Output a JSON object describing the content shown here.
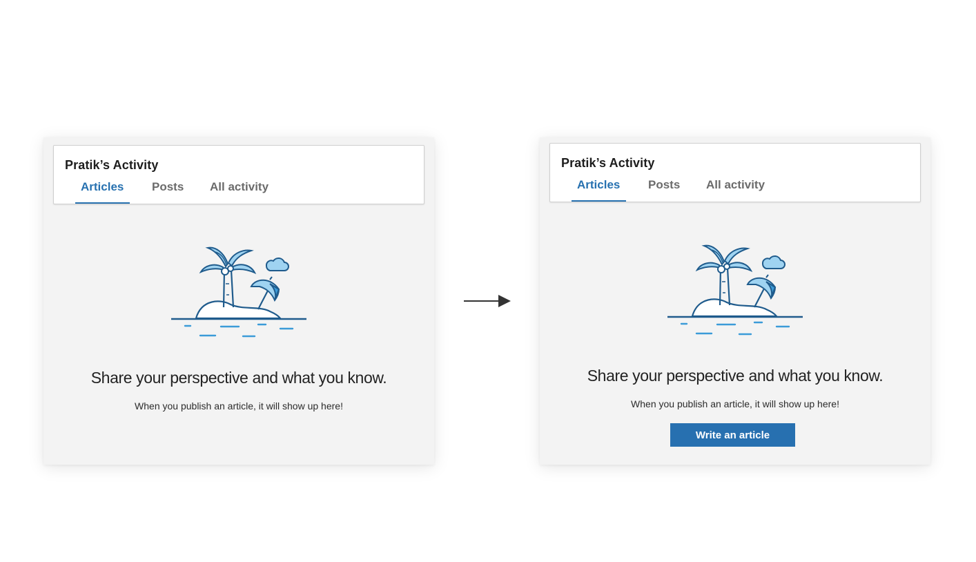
{
  "before": {
    "header": {
      "title": "Pratik’s Activity"
    },
    "tabs": [
      {
        "label": "Articles",
        "active": true
      },
      {
        "label": "Posts",
        "active": false
      },
      {
        "label": "All activity",
        "active": false
      }
    ],
    "empty_state": {
      "illustration": "island-palm-tree-icon",
      "headline": "Share your perspective and what you know.",
      "subtext": "When you publish an article, it will show up here!"
    }
  },
  "after": {
    "header": {
      "title": "Pratik’s Activity"
    },
    "tabs": [
      {
        "label": "Articles",
        "active": true
      },
      {
        "label": "Posts",
        "active": false
      },
      {
        "label": "All activity",
        "active": false
      }
    ],
    "empty_state": {
      "illustration": "island-palm-tree-icon",
      "headline": "Share your perspective and what you know.",
      "subtext": "When you publish an article, it will show up here!",
      "cta_label": "Write an article"
    }
  },
  "transition_icon": "right-arrow-icon",
  "colors": {
    "accent": "#2771b0",
    "panel_background": "#f3f3f3",
    "inactive_tab": "#6b6b6b",
    "illustration_dark": "#1f5b8c",
    "illustration_light": "#9fd3f1",
    "water": "#3b9bd8"
  }
}
